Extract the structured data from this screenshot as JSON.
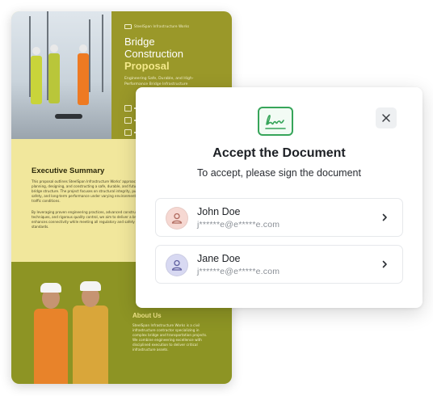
{
  "document": {
    "brand": "SteelSpan Infrastructure Works",
    "title_line1": "Bridge",
    "title_line2": "Construction",
    "title_accent": "Proposal",
    "subtitle": "Engineering Safe, Durable, and High-Performance Bridge Infrastructure",
    "exec_heading": "Executive Summary",
    "exec_p1": "This proposal outlines SteelSpan Infrastructure Works' approach to planning, designing, and constructing a safe, durable, and future-ready bridge structure. The project focuses on structural integrity, public safety, and long-term performance under varying environmental and traffic conditions.",
    "exec_p2": "By leveraging proven engineering practices, advanced construction techniques, and rigorous quality control, we aim to deliver a bridge that enhances connectivity while meeting all regulatory and safety standards.",
    "about_heading": "About Us",
    "about_p": "SteelSpan Infrastructure Works is a civil infrastructure contractor specializing in complex bridge and transportation projects. We combine engineering excellence with disciplined execution to deliver critical infrastructure assets."
  },
  "dialog": {
    "title": "Accept the Document",
    "subtitle": "To accept, please sign the document",
    "close_icon": "close-icon",
    "signature_icon": "signature-icon",
    "signers": [
      {
        "name": "John Doe",
        "email": "j******e@e*****e.com",
        "avatar_color": "#f6d8d2",
        "avatar_stroke": "#b06a5e"
      },
      {
        "name": "Jane Doe",
        "email": "j******e@e*****e.com",
        "avatar_color": "#d8d9f2",
        "avatar_stroke": "#5f5fa0"
      }
    ]
  },
  "colors": {
    "accent_green": "#37a55a",
    "doc_olive": "#9a9829",
    "doc_yellow": "#f1e79c"
  }
}
